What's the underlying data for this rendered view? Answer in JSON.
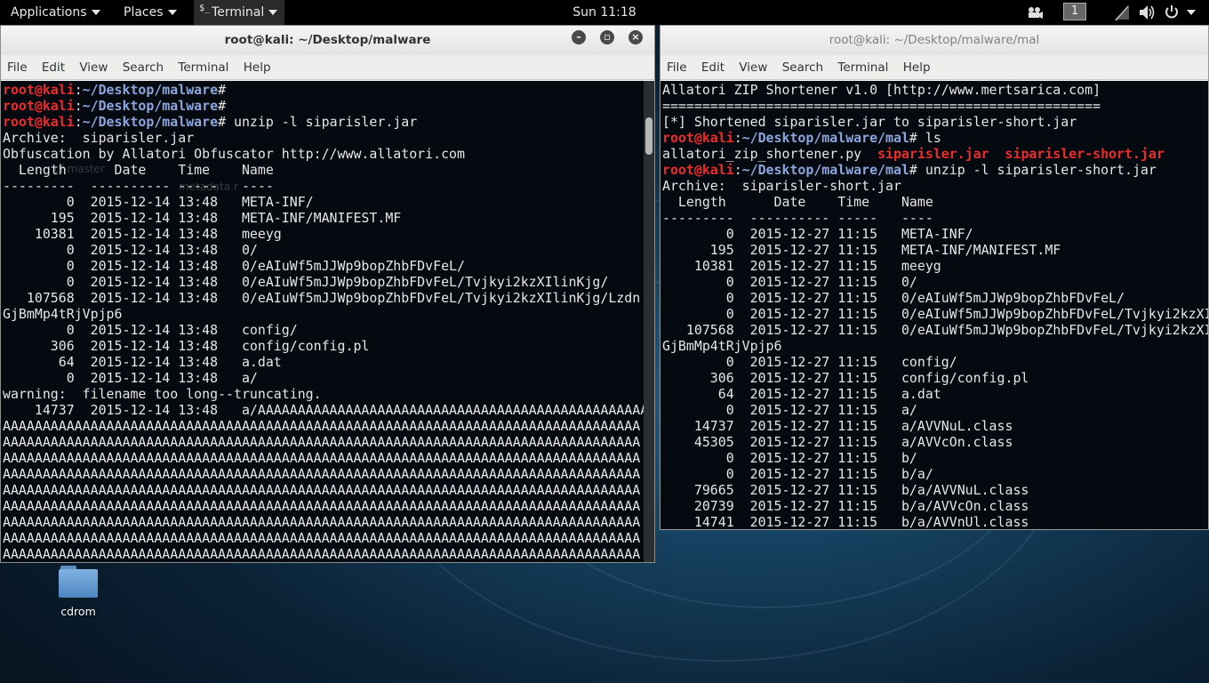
{
  "topbar": {
    "applications": "Applications",
    "places": "Places",
    "terminal_app": "Terminal",
    "clock": "Sun 11:18",
    "workspace": "1"
  },
  "left_terminal": {
    "title": "root@kali: ~/Desktop/malware",
    "menu": [
      "File",
      "Edit",
      "View",
      "Search",
      "Terminal",
      "Help"
    ],
    "lines": [
      [
        {
          "t": "root@kali",
          "c": "pu"
        },
        {
          "t": ":",
          "c": ""
        },
        {
          "t": "~/Desktop/malware",
          "c": "pp"
        },
        {
          "t": "#",
          "c": ""
        }
      ],
      [
        {
          "t": "root@kali",
          "c": "pu"
        },
        {
          "t": ":",
          "c": ""
        },
        {
          "t": "~/Desktop/malware",
          "c": "pp"
        },
        {
          "t": "#",
          "c": ""
        }
      ],
      [
        {
          "t": "root@kali",
          "c": "pu"
        },
        {
          "t": ":",
          "c": ""
        },
        {
          "t": "~/Desktop/malware",
          "c": "pp"
        },
        {
          "t": "# unzip -l siparisler.jar",
          "c": ""
        }
      ],
      [
        {
          "t": "Archive:  siparisler.jar",
          "c": ""
        }
      ],
      [
        {
          "t": "Obfuscation by Allatori Obfuscator http://www.allatori.com",
          "c": ""
        }
      ],
      [
        {
          "t": "  Length      Date    Time    Name",
          "c": ""
        }
      ],
      [
        {
          "t": "---------  ---------- -----   ----",
          "c": ""
        }
      ],
      [
        {
          "t": "        0  2015-12-14 13:48   META-INF/",
          "c": ""
        }
      ],
      [
        {
          "t": "      195  2015-12-14 13:48   META-INF/MANIFEST.MF",
          "c": ""
        }
      ],
      [
        {
          "t": "    10381  2015-12-14 13:48   meeyg",
          "c": ""
        }
      ],
      [
        {
          "t": "        0  2015-12-14 13:48   0/",
          "c": ""
        }
      ],
      [
        {
          "t": "        0  2015-12-14 13:48   0/eAIuWf5mJJWp9bopZhbFDvFeL/",
          "c": ""
        }
      ],
      [
        {
          "t": "        0  2015-12-14 13:48   0/eAIuWf5mJJWp9bopZhbFDvFeL/Tvjkyi2kzXIlinKjg/",
          "c": ""
        }
      ],
      [
        {
          "t": "   107568  2015-12-14 13:48   0/eAIuWf5mJJWp9bopZhbFDvFeL/Tvjkyi2kzXIlinKjg/Lzdn",
          "c": ""
        }
      ],
      [
        {
          "t": "GjBmMp4tRjVpjp6",
          "c": ""
        }
      ],
      [
        {
          "t": "        0  2015-12-14 13:48   config/",
          "c": ""
        }
      ],
      [
        {
          "t": "      306  2015-12-14 13:48   config/config.pl",
          "c": ""
        }
      ],
      [
        {
          "t": "       64  2015-12-14 13:48   a.dat",
          "c": ""
        }
      ],
      [
        {
          "t": "        0  2015-12-14 13:48   a/",
          "c": ""
        }
      ],
      [
        {
          "t": "warning:  filename too long--truncating.",
          "c": ""
        }
      ],
      [
        {
          "t": "    14737  2015-12-14 13:48   a/AAAAAAAAAAAAAAAAAAAAAAAAAAAAAAAAAAAAAAAAAAAAAAAAA",
          "c": ""
        }
      ],
      [
        {
          "t": "AAAAAAAAAAAAAAAAAAAAAAAAAAAAAAAAAAAAAAAAAAAAAAAAAAAAAAAAAAAAAAAAAAAAAAAAAAAAAAAA",
          "c": ""
        }
      ],
      [
        {
          "t": "AAAAAAAAAAAAAAAAAAAAAAAAAAAAAAAAAAAAAAAAAAAAAAAAAAAAAAAAAAAAAAAAAAAAAAAAAAAAAAAA",
          "c": ""
        }
      ],
      [
        {
          "t": "AAAAAAAAAAAAAAAAAAAAAAAAAAAAAAAAAAAAAAAAAAAAAAAAAAAAAAAAAAAAAAAAAAAAAAAAAAAAAAAA",
          "c": ""
        }
      ],
      [
        {
          "t": "AAAAAAAAAAAAAAAAAAAAAAAAAAAAAAAAAAAAAAAAAAAAAAAAAAAAAAAAAAAAAAAAAAAAAAAAAAAAAAAA",
          "c": ""
        }
      ],
      [
        {
          "t": "AAAAAAAAAAAAAAAAAAAAAAAAAAAAAAAAAAAAAAAAAAAAAAAAAAAAAAAAAAAAAAAAAAAAAAAAAAAAAAAA",
          "c": ""
        }
      ],
      [
        {
          "t": "AAAAAAAAAAAAAAAAAAAAAAAAAAAAAAAAAAAAAAAAAAAAAAAAAAAAAAAAAAAAAAAAAAAAAAAAAAAAAAAA",
          "c": ""
        }
      ],
      [
        {
          "t": "AAAAAAAAAAAAAAAAAAAAAAAAAAAAAAAAAAAAAAAAAAAAAAAAAAAAAAAAAAAAAAAAAAAAAAAAAAAAAAAA",
          "c": ""
        }
      ],
      [
        {
          "t": "AAAAAAAAAAAAAAAAAAAAAAAAAAAAAAAAAAAAAAAAAAAAAAAAAAAAAAAAAAAAAAAAAAAAAAAAAAAAAAAA",
          "c": ""
        }
      ],
      [
        {
          "t": "AAAAAAAAAAAAAAAAAAAAAAAAAAAAAAAAAAAAAAAAAAAAAAAAAAAAAAAAAAAAAAAAAAAAAAAAAAAAAAAA",
          "c": ""
        }
      ]
    ]
  },
  "right_terminal": {
    "title": "root@kali: ~/Desktop/malware/mal",
    "menu": [
      "File",
      "Edit",
      "View",
      "Search",
      "Terminal",
      "Help"
    ],
    "lines": [
      [
        {
          "t": "Allatori ZIP Shortener v1.0 [http://www.mertsarica.com]",
          "c": ""
        }
      ],
      [
        {
          "t": "=======================================================",
          "c": ""
        }
      ],
      [
        {
          "t": "[*] Shortened siparisler.jar to siparisler-short.jar",
          "c": ""
        }
      ],
      [
        {
          "t": "root@kali",
          "c": "pu"
        },
        {
          "t": ":",
          "c": ""
        },
        {
          "t": "~/Desktop/malware/mal",
          "c": "pp"
        },
        {
          "t": "# ls",
          "c": ""
        }
      ],
      [
        {
          "t": "allatori_zip_shortener.py  ",
          "c": ""
        },
        {
          "t": "siparisler.jar",
          "c": "pr"
        },
        {
          "t": "  ",
          "c": ""
        },
        {
          "t": "siparisler-short.jar",
          "c": "pr"
        }
      ],
      [
        {
          "t": "root@kali",
          "c": "pu"
        },
        {
          "t": ":",
          "c": ""
        },
        {
          "t": "~/Desktop/malware/mal",
          "c": "pp"
        },
        {
          "t": "# unzip -l siparisler-short.jar",
          "c": ""
        }
      ],
      [
        {
          "t": "Archive:  siparisler-short.jar",
          "c": ""
        }
      ],
      [
        {
          "t": "  Length      Date    Time    Name",
          "c": ""
        }
      ],
      [
        {
          "t": "---------  ---------- -----   ----",
          "c": ""
        }
      ],
      [
        {
          "t": "        0  2015-12-27 11:15   META-INF/",
          "c": ""
        }
      ],
      [
        {
          "t": "      195  2015-12-27 11:15   META-INF/MANIFEST.MF",
          "c": ""
        }
      ],
      [
        {
          "t": "    10381  2015-12-27 11:15   meeyg",
          "c": ""
        }
      ],
      [
        {
          "t": "        0  2015-12-27 11:15   0/",
          "c": ""
        }
      ],
      [
        {
          "t": "        0  2015-12-27 11:15   0/eAIuWf5mJJWp9bopZhbFDvFeL/",
          "c": ""
        }
      ],
      [
        {
          "t": "        0  2015-12-27 11:15   0/eAIuWf5mJJWp9bopZhbFDvFeL/Tvjkyi2kzXI",
          "c": ""
        }
      ],
      [
        {
          "t": "   107568  2015-12-27 11:15   0/eAIuWf5mJJWp9bopZhbFDvFeL/Tvjkyi2kzXI",
          "c": ""
        }
      ],
      [
        {
          "t": "GjBmMp4tRjVpjp6",
          "c": ""
        }
      ],
      [
        {
          "t": "        0  2015-12-27 11:15   config/",
          "c": ""
        }
      ],
      [
        {
          "t": "      306  2015-12-27 11:15   config/config.pl",
          "c": ""
        }
      ],
      [
        {
          "t": "       64  2015-12-27 11:15   a.dat",
          "c": ""
        }
      ],
      [
        {
          "t": "        0  2015-12-27 11:15   a/",
          "c": ""
        }
      ],
      [
        {
          "t": "    14737  2015-12-27 11:15   a/AVVNuL.class",
          "c": ""
        }
      ],
      [
        {
          "t": "    45305  2015-12-27 11:15   a/AVVcOn.class",
          "c": ""
        }
      ],
      [
        {
          "t": "        0  2015-12-27 11:15   b/",
          "c": ""
        }
      ],
      [
        {
          "t": "        0  2015-12-27 11:15   b/a/",
          "c": ""
        }
      ],
      [
        {
          "t": "    79665  2015-12-27 11:15   b/a/AVVNuL.class",
          "c": ""
        }
      ],
      [
        {
          "t": "    20739  2015-12-27 11:15   b/a/AVVcOn.class",
          "c": ""
        }
      ],
      [
        {
          "t": "    14741  2015-12-27 11:15   b/a/AVVnUl.class",
          "c": ""
        }
      ]
    ]
  },
  "desktop": {
    "icons": [
      {
        "label": "cdrom",
        "icon": "folder-icon"
      }
    ]
  },
  "colors": {
    "prompt_user": "#ee2c2c",
    "prompt_path": "#8ca6dd",
    "terminal_bg": "#050a10",
    "panel_bg": "#000000"
  }
}
